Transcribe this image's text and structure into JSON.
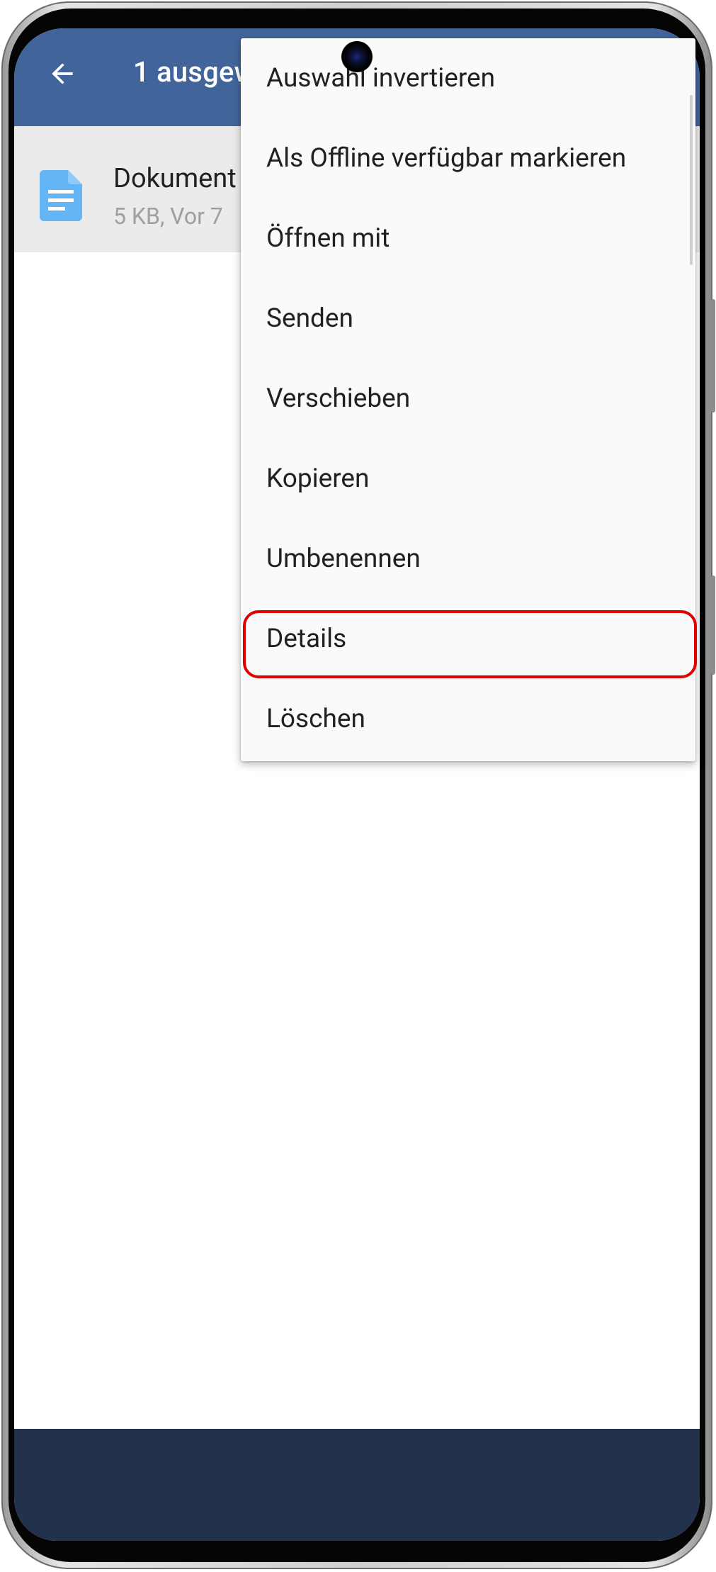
{
  "app_bar": {
    "title": "1 ausgewählt",
    "accent_color": "#41659a"
  },
  "file": {
    "name": "Dokument",
    "meta": "5 KB, Vor 7",
    "icon": "document-icon"
  },
  "menu": {
    "items": [
      {
        "label": "Auswahl invertieren"
      },
      {
        "label": "Als Offline verfügbar markieren"
      },
      {
        "label": "Öffnen mit"
      },
      {
        "label": "Senden"
      },
      {
        "label": "Verschieben"
      },
      {
        "label": "Kopieren"
      },
      {
        "label": "Umbenennen"
      },
      {
        "label": "Details"
      },
      {
        "label": "Löschen"
      }
    ],
    "highlighted_label": "Details",
    "highlight_color": "#e00000"
  },
  "bottom_bar": {
    "color": "#22314c"
  }
}
